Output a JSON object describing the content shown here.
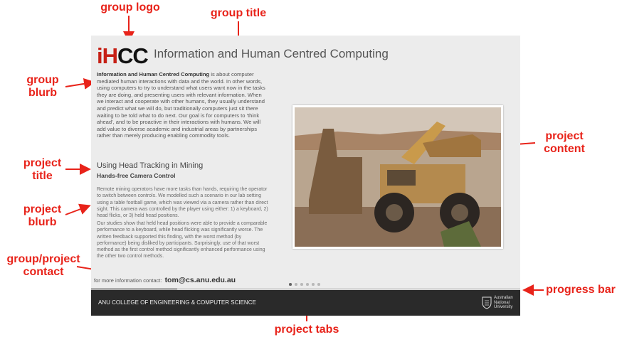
{
  "annotations": {
    "group_logo": "group logo",
    "group_title": "group title",
    "group_blurb": "group\nblurb",
    "project_title": "project\ntitle",
    "project_blurb": "project\nblurb",
    "group_project_contact": "group/project\ncontact",
    "project_content": "project\ncontent",
    "progress_bar": "progress bar",
    "project_tabs": "project tabs"
  },
  "screen": {
    "logo_red": "iH",
    "logo_black": "CC",
    "logo_icon": "ihcc-logo-icon",
    "group_title": "Information and Human Centred Computing",
    "group_blurb_bold": "Information and Human Centred Computing",
    "group_blurb_rest": " is about computer mediated human interactions with data and the world. In other words, using computers to try to understand what users want now in the tasks they are doing, and presenting users with relevant information. When we interact and cooperate with other humans, they usually understand and predict what we will do, but traditionally computers just sit there waiting to be told what to do next. Our goal is for computers to 'think ahead', and to be proactive in their interactions with humans. We will add value to diverse academic and industrial areas by partnerships rather than merely producing enabling commodity tools.",
    "project_title": "Using Head Tracking in Mining",
    "project_subtitle": "Hands-free Camera Control",
    "project_blurb_1": "Remote mining operators have more tasks than hands, requiring the operator to switch between controls. We modelled such a scenario in our lab setting using a table football game, which was viewed via a camera rather than direct sight. This camera was controlled by the player using either: 1) a keyboard, 2) head flicks, or 3) held head positions.",
    "project_blurb_2": "Our studies show that held head positions were able to provide a comparable performance to a keyboard, while head flicking was significantly worse. The written feedback supported this finding, with the worst method (by performance) being disliked by participants. Surprisingly, use of that worst method as the first control method significantly enhanced performance using the other two control methods.",
    "contact_label": "for more information contact:",
    "contact_email": "tom@cs.anu.edu.au",
    "project_content_image": "mining-truck-photo",
    "progress_fraction": 0.2,
    "tabs": {
      "count": 6,
      "active": 0
    },
    "footer_text": "ANU COLLEGE OF ENGINEERING & COMPUTER SCIENCE",
    "anu_crest_icon": "anu-crest-icon",
    "anu_name_line1": "Australian",
    "anu_name_line2": "National",
    "anu_name_line3": "University"
  },
  "colors": {
    "annotation": "#e8231a",
    "logo_red": "#c62016",
    "footer": "#2a2a2a",
    "screen_bg": "#ececec"
  }
}
